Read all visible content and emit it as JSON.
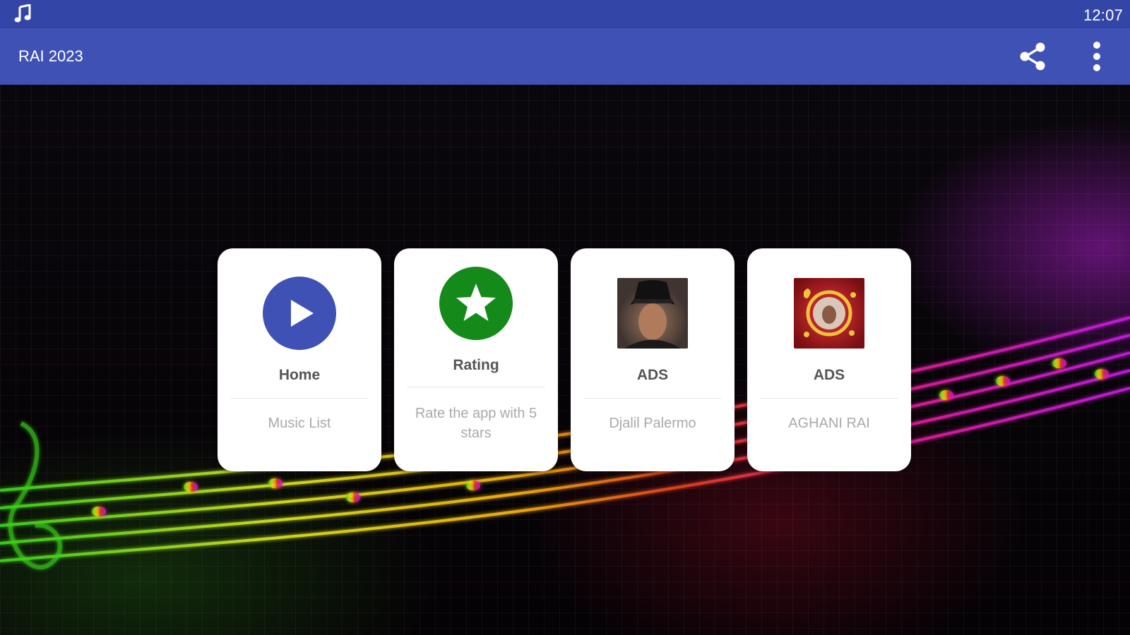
{
  "status_bar": {
    "time": "12:07",
    "icon": "music-note-icon"
  },
  "app_bar": {
    "title": "RAI 2023",
    "actions": [
      "share-icon",
      "more-vert-icon"
    ]
  },
  "cards": [
    {
      "icon": "play-icon",
      "title": "Home",
      "subtitle": "Music List",
      "icon_color": "#3f51b5"
    },
    {
      "icon": "star-icon",
      "title": "Rating",
      "subtitle": "Rate the app with 5 stars",
      "icon_color": "#138a1a"
    },
    {
      "icon": "artist-photo",
      "title": "ADS",
      "subtitle": "Djalil Palermo"
    },
    {
      "icon": "album-cover",
      "title": "ADS",
      "subtitle": "AGHANI RAI"
    }
  ],
  "colors": {
    "status_bar": "#3346a8",
    "app_bar": "#3f51b5"
  }
}
